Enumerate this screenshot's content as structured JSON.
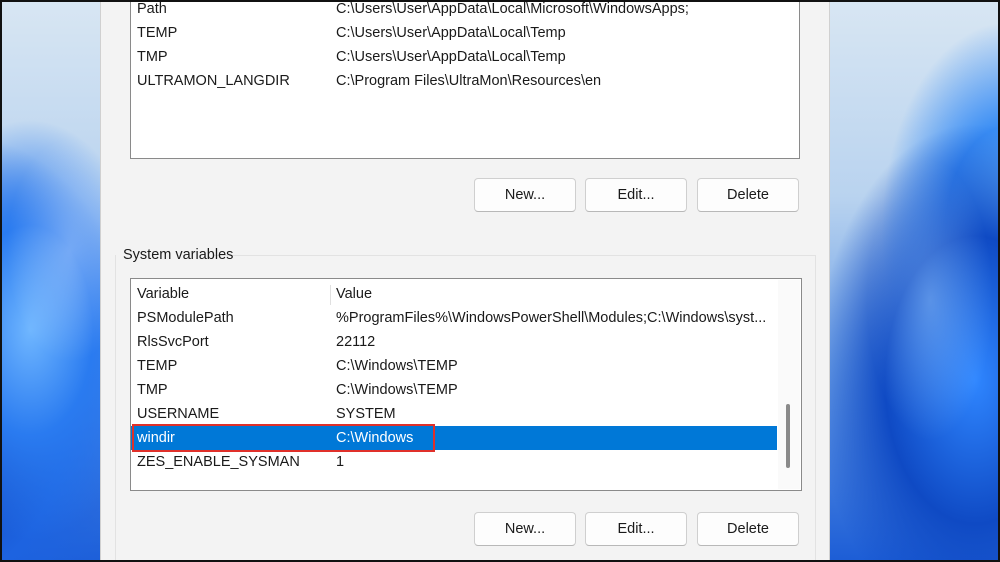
{
  "user_variables": {
    "rows": [
      {
        "variable": "Path",
        "value": "C:\\Users\\User\\AppData\\Local\\Microsoft\\WindowsApps;"
      },
      {
        "variable": "TEMP",
        "value": "C:\\Users\\User\\AppData\\Local\\Temp"
      },
      {
        "variable": "TMP",
        "value": "C:\\Users\\User\\AppData\\Local\\Temp"
      },
      {
        "variable": "ULTRAMON_LANGDIR",
        "value": "C:\\Program Files\\UltraMon\\Resources\\en"
      }
    ],
    "buttons": {
      "new": "New...",
      "edit": "Edit...",
      "delete": "Delete"
    }
  },
  "system_variables": {
    "group_label": "System variables",
    "columns": {
      "variable": "Variable",
      "value": "Value"
    },
    "rows": [
      {
        "variable": "PSModulePath",
        "value": "%ProgramFiles%\\WindowsPowerShell\\Modules;C:\\Windows\\syst..."
      },
      {
        "variable": "RlsSvcPort",
        "value": "22112"
      },
      {
        "variable": "TEMP",
        "value": "C:\\Windows\\TEMP"
      },
      {
        "variable": "TMP",
        "value": "C:\\Windows\\TEMP"
      },
      {
        "variable": "USERNAME",
        "value": "SYSTEM"
      },
      {
        "variable": "windir",
        "value": "C:\\Windows",
        "selected": true
      },
      {
        "variable": "ZES_ENABLE_SYSMAN",
        "value": "1"
      }
    ],
    "buttons": {
      "new": "New...",
      "edit": "Edit...",
      "delete": "Delete"
    }
  },
  "colors": {
    "selection": "#0078d7",
    "highlight_box": "#e0302a"
  }
}
